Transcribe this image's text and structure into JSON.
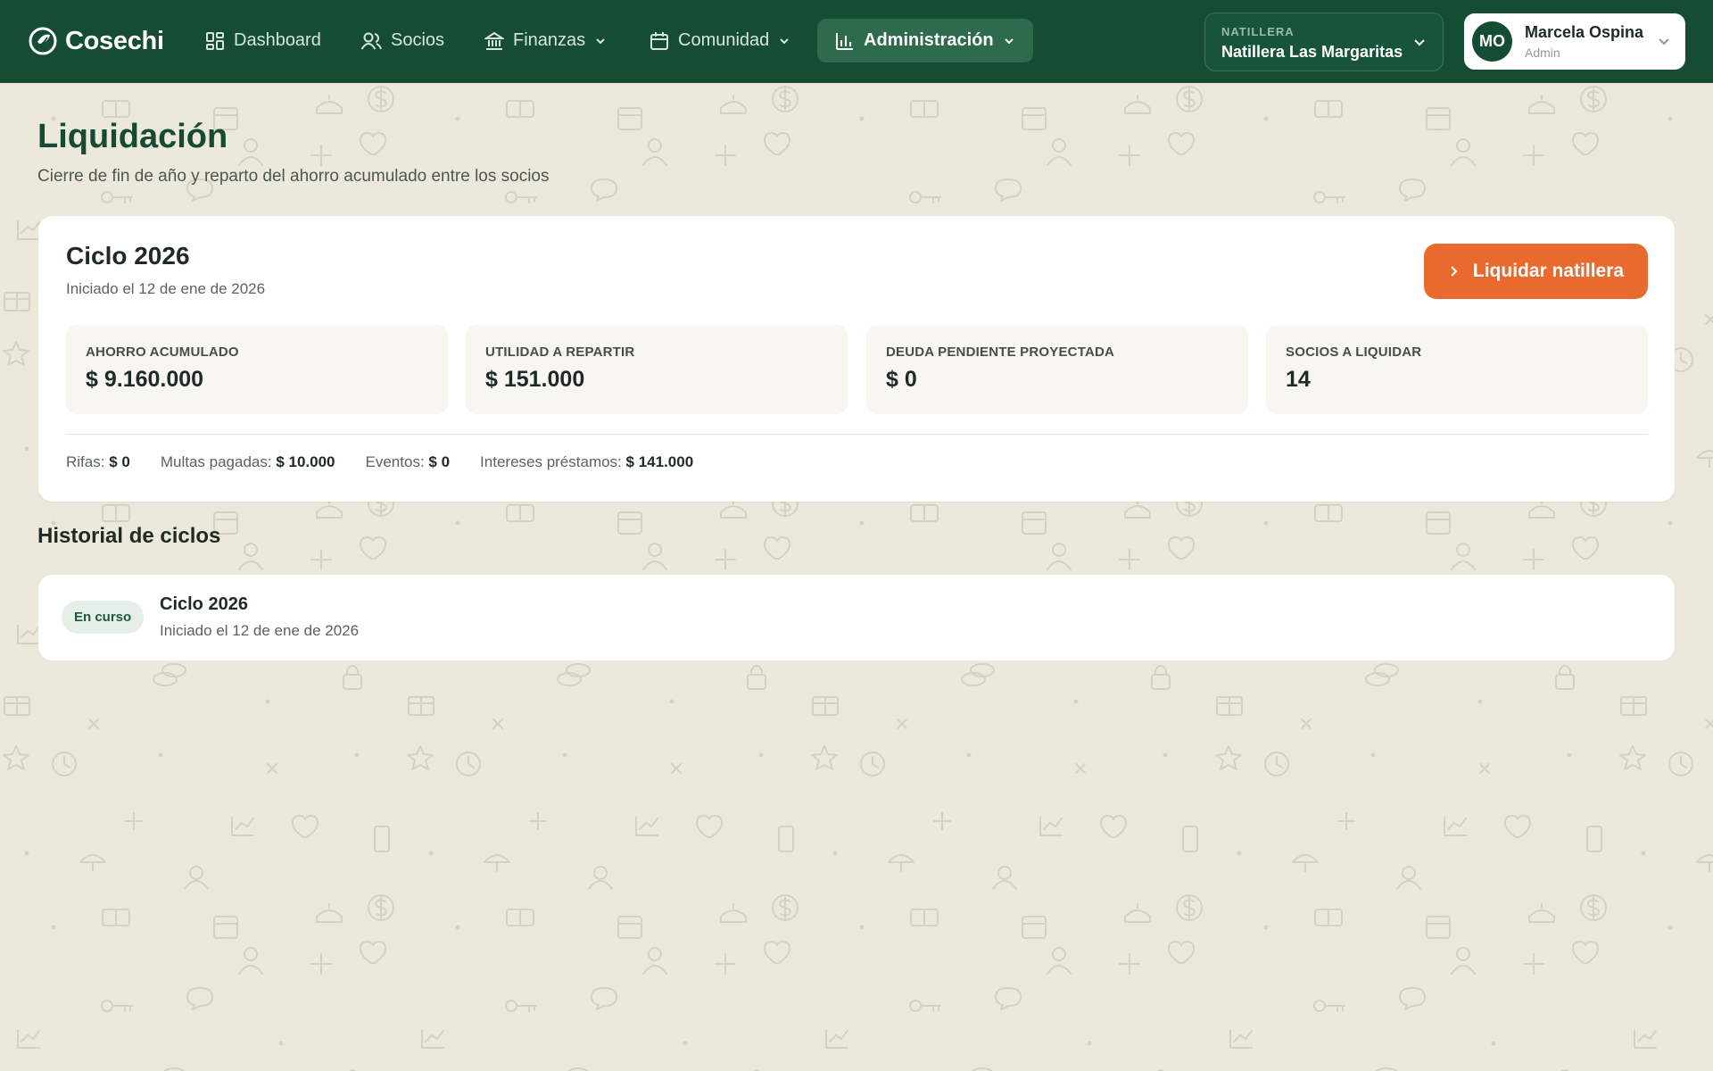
{
  "app": {
    "name": "Cosechi"
  },
  "nav": {
    "items": [
      {
        "label": "Dashboard",
        "icon": "dashboard-icon"
      },
      {
        "label": "Socios",
        "icon": "users-icon"
      },
      {
        "label": "Finanzas",
        "icon": "bank-icon",
        "dropdown": true
      },
      {
        "label": "Comunidad",
        "icon": "calendar-icon",
        "dropdown": true
      },
      {
        "label": "Administración",
        "icon": "bar-chart-icon",
        "dropdown": true,
        "active": true
      }
    ]
  },
  "org_selector": {
    "label": "NATILLERA",
    "value": "Natillera Las Margaritas"
  },
  "user": {
    "initials": "MO",
    "name": "Marcela Ospina",
    "role": "Admin"
  },
  "page": {
    "title": "Liquidación",
    "subtitle": "Cierre de fin de año y reparto del ahorro acumulado entre los socios"
  },
  "cycle": {
    "title": "Ciclo 2026",
    "started": "Iniciado el 12 de ene de 2026",
    "action_label": "Liquidar natillera",
    "stats": [
      {
        "label": "AHORRO ACUMULADO",
        "value": "$ 9.160.000"
      },
      {
        "label": "UTILIDAD A REPARTIR",
        "value": "$ 151.000"
      },
      {
        "label": "DEUDA PENDIENTE PROYECTADA",
        "value": "$ 0"
      },
      {
        "label": "SOCIOS A LIQUIDAR",
        "value": "14"
      }
    ],
    "breakdown": [
      {
        "label": "Rifas:",
        "value": "$ 0"
      },
      {
        "label": "Multas pagadas:",
        "value": "$ 10.000"
      },
      {
        "label": "Eventos:",
        "value": "$ 0"
      },
      {
        "label": "Intereses préstamos:",
        "value": "$ 141.000"
      }
    ]
  },
  "history": {
    "title": "Historial de ciclos",
    "items": [
      {
        "status": "En curso",
        "title": "Ciclo 2026",
        "started": "Iniciado el 12 de ene de 2026"
      }
    ]
  },
  "colors": {
    "header_bg": "#144c34",
    "accent": "#e96a2f",
    "page_bg": "#ece8dc",
    "title_green": "#154b33"
  }
}
